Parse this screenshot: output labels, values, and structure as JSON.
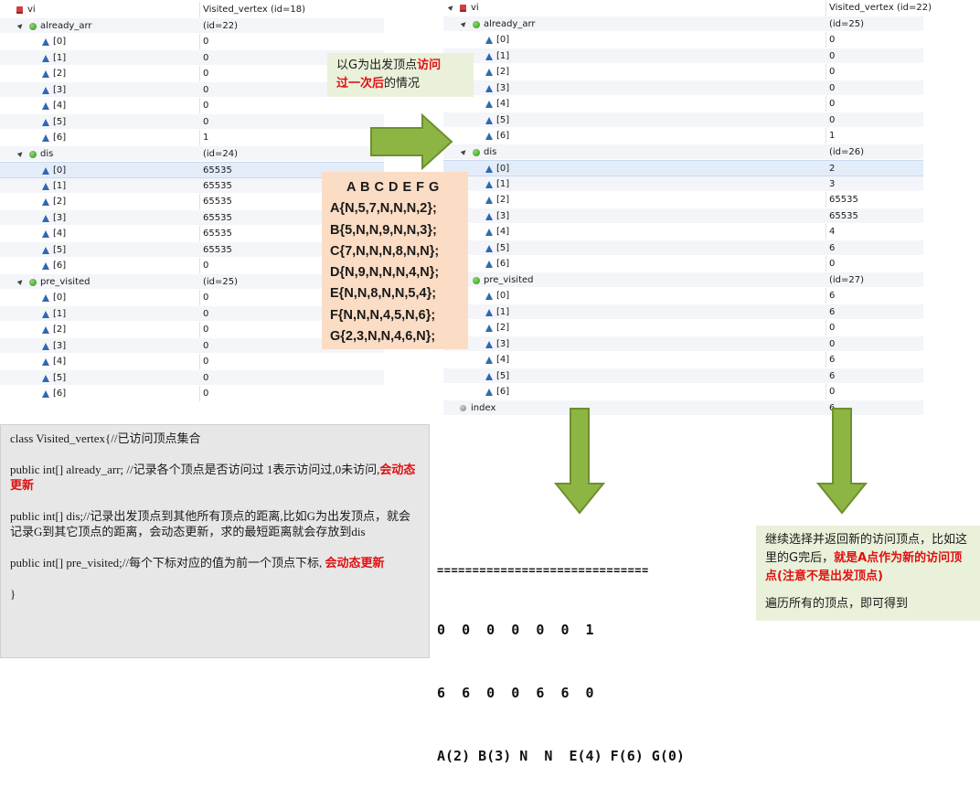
{
  "left_panel": {
    "rows": [
      {
        "indent": 0,
        "twisty": "",
        "icon": "red",
        "name": "vi",
        "value": "Visited_vertex  (id=18)"
      },
      {
        "indent": 1,
        "twisty": "▲",
        "icon": "green",
        "name": "already_arr",
        "value": "(id=22)"
      },
      {
        "indent": 2,
        "twisty": "",
        "icon": "tri",
        "name": "[0]",
        "value": "0"
      },
      {
        "indent": 2,
        "twisty": "",
        "icon": "tri",
        "name": "[1]",
        "value": "0"
      },
      {
        "indent": 2,
        "twisty": "",
        "icon": "tri",
        "name": "[2]",
        "value": "0"
      },
      {
        "indent": 2,
        "twisty": "",
        "icon": "tri",
        "name": "[3]",
        "value": "0"
      },
      {
        "indent": 2,
        "twisty": "",
        "icon": "tri",
        "name": "[4]",
        "value": "0"
      },
      {
        "indent": 2,
        "twisty": "",
        "icon": "tri",
        "name": "[5]",
        "value": "0"
      },
      {
        "indent": 2,
        "twisty": "",
        "icon": "tri",
        "name": "[6]",
        "value": "1"
      },
      {
        "indent": 1,
        "twisty": "▲",
        "icon": "green",
        "name": "dis",
        "value": "(id=24)"
      },
      {
        "indent": 2,
        "twisty": "",
        "icon": "tri",
        "name": "[0]",
        "value": "65535",
        "selected": true
      },
      {
        "indent": 2,
        "twisty": "",
        "icon": "tri",
        "name": "[1]",
        "value": "65535"
      },
      {
        "indent": 2,
        "twisty": "",
        "icon": "tri",
        "name": "[2]",
        "value": "65535"
      },
      {
        "indent": 2,
        "twisty": "",
        "icon": "tri",
        "name": "[3]",
        "value": "65535"
      },
      {
        "indent": 2,
        "twisty": "",
        "icon": "tri",
        "name": "[4]",
        "value": "65535"
      },
      {
        "indent": 2,
        "twisty": "",
        "icon": "tri",
        "name": "[5]",
        "value": "65535"
      },
      {
        "indent": 2,
        "twisty": "",
        "icon": "tri",
        "name": "[6]",
        "value": "0"
      },
      {
        "indent": 1,
        "twisty": "▲",
        "icon": "green",
        "name": "pre_visited",
        "value": "(id=25)"
      },
      {
        "indent": 2,
        "twisty": "",
        "icon": "tri",
        "name": "[0]",
        "value": "0"
      },
      {
        "indent": 2,
        "twisty": "",
        "icon": "tri",
        "name": "[1]",
        "value": "0"
      },
      {
        "indent": 2,
        "twisty": "",
        "icon": "tri",
        "name": "[2]",
        "value": "0"
      },
      {
        "indent": 2,
        "twisty": "",
        "icon": "tri",
        "name": "[3]",
        "value": "0"
      },
      {
        "indent": 2,
        "twisty": "",
        "icon": "tri",
        "name": "[4]",
        "value": "0"
      },
      {
        "indent": 2,
        "twisty": "",
        "icon": "tri",
        "name": "[5]",
        "value": "0"
      },
      {
        "indent": 2,
        "twisty": "",
        "icon": "tri",
        "name": "[6]",
        "value": "0"
      }
    ]
  },
  "right_panel": {
    "rows": [
      {
        "indent": 0,
        "twisty": "▲",
        "icon": "red",
        "name": "vi",
        "value": "Visited_vertex  (id=22)"
      },
      {
        "indent": 1,
        "twisty": "▲",
        "icon": "green",
        "name": "already_arr",
        "value": "(id=25)"
      },
      {
        "indent": 2,
        "twisty": "",
        "icon": "tri",
        "name": "[0]",
        "value": "0"
      },
      {
        "indent": 2,
        "twisty": "",
        "icon": "tri",
        "name": "[1]",
        "value": "0"
      },
      {
        "indent": 2,
        "twisty": "",
        "icon": "tri",
        "name": "[2]",
        "value": "0"
      },
      {
        "indent": 2,
        "twisty": "",
        "icon": "tri",
        "name": "[3]",
        "value": "0"
      },
      {
        "indent": 2,
        "twisty": "",
        "icon": "tri",
        "name": "[4]",
        "value": "0"
      },
      {
        "indent": 2,
        "twisty": "",
        "icon": "tri",
        "name": "[5]",
        "value": "0"
      },
      {
        "indent": 2,
        "twisty": "",
        "icon": "tri",
        "name": "[6]",
        "value": "1"
      },
      {
        "indent": 1,
        "twisty": "▲",
        "icon": "green",
        "name": "dis",
        "value": "(id=26)"
      },
      {
        "indent": 2,
        "twisty": "",
        "icon": "tri",
        "name": "[0]",
        "value": "2",
        "selected": true
      },
      {
        "indent": 2,
        "twisty": "",
        "icon": "tri",
        "name": "[1]",
        "value": "3"
      },
      {
        "indent": 2,
        "twisty": "",
        "icon": "tri",
        "name": "[2]",
        "value": "65535"
      },
      {
        "indent": 2,
        "twisty": "",
        "icon": "tri",
        "name": "[3]",
        "value": "65535"
      },
      {
        "indent": 2,
        "twisty": "",
        "icon": "tri",
        "name": "[4]",
        "value": "4"
      },
      {
        "indent": 2,
        "twisty": "",
        "icon": "tri",
        "name": "[5]",
        "value": "6"
      },
      {
        "indent": 2,
        "twisty": "",
        "icon": "tri",
        "name": "[6]",
        "value": "0"
      },
      {
        "indent": 1,
        "twisty": "▲",
        "icon": "green",
        "name": "pre_visited",
        "value": "(id=27)"
      },
      {
        "indent": 2,
        "twisty": "",
        "icon": "tri",
        "name": "[0]",
        "value": "6"
      },
      {
        "indent": 2,
        "twisty": "",
        "icon": "tri",
        "name": "[1]",
        "value": "6"
      },
      {
        "indent": 2,
        "twisty": "",
        "icon": "tri",
        "name": "[2]",
        "value": "0"
      },
      {
        "indent": 2,
        "twisty": "",
        "icon": "tri",
        "name": "[3]",
        "value": "0"
      },
      {
        "indent": 2,
        "twisty": "",
        "icon": "tri",
        "name": "[4]",
        "value": "6"
      },
      {
        "indent": 2,
        "twisty": "",
        "icon": "tri",
        "name": "[5]",
        "value": "6"
      },
      {
        "indent": 2,
        "twisty": "",
        "icon": "tri",
        "name": "[6]",
        "value": "0"
      },
      {
        "indent": 0,
        "twisty": "",
        "icon": "gray",
        "name": "index",
        "value": "6"
      }
    ]
  },
  "callout_title": {
    "part1": "以G为出发顶点",
    "part2_red": "访问",
    "part3_red": "过一次后",
    "part4": "的情况"
  },
  "matrix": {
    "header": "A  B C D E  F  G",
    "lines": [
      "A{N,5,7,N,N,N,2};",
      "B{5,N,N,9,N,N,3};",
      "C{7,N,N,N,8,N,N};",
      "D{N,9,N,N,N,4,N};",
      "E{N,N,8,N,N,5,4};",
      "F{N,N,N,4,5,N,6};",
      "G{2,3,N,N,4,6,N};"
    ]
  },
  "code_box": {
    "line1": "class Visited_vertex{//已访问顶点集合",
    "line2": "public int[] already_arr; //记录各个顶点是否访问过 1表示访问过,0未访问,",
    "line2_red": "会动态更新",
    "line3": "public int[] dis;//记录出发顶点到其他所有顶点的距离,比如G为出发顶点，就会记录G到其它顶点的距离，会动态更新，求的最短距离就会存放到dis",
    "line4": "public int[] pre_visited;//每个下标对应的值为前一个顶点下标,",
    "line4_red": "会动态更新",
    "line5": "}"
  },
  "console": {
    "separator": "==============================",
    "line1": "0  0  0  0  0  0  1",
    "line2": "6  6  0  0  6  6  0",
    "line3": "A(2) B(3) N  N  E(4) F(6) G(0)"
  },
  "info_box": {
    "part1": "继续选择并返回新的访问顶点，比如这里的G完后，",
    "part2_red": "就是A点作为新的访问顶点(注意不是出发顶点)",
    "part3": "遍历所有的顶点，即可得到"
  },
  "colors": {
    "arrow_green": "#8db543",
    "arrow_green_dark": "#6e8f2f",
    "red_text": "#e01010",
    "callout_bg": "#e9f1da",
    "matrix_bg": "#fbdcc4",
    "code_bg": "#e7e7e7"
  }
}
